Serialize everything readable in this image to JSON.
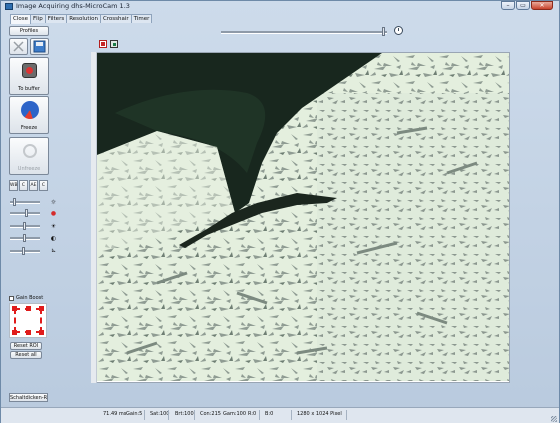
{
  "window": {
    "title": "Image Acquiring dhs-MicroCam 1.3",
    "min_glyph": "–",
    "max_glyph": "▭",
    "close_glyph": "✕"
  },
  "tabs": [
    {
      "label": "Close"
    },
    {
      "label": "Flip"
    },
    {
      "label": "Filters"
    },
    {
      "label": "Resolution"
    },
    {
      "label": "Crosshair"
    },
    {
      "label": "Timer"
    }
  ],
  "left_panel": {
    "profiles_label": "Profiles",
    "to_buffer_label": "To buffer",
    "freeze_label": "Freeze",
    "unfreeze_label": "Unfreeze",
    "wb_buttons": [
      "WB",
      "C",
      "AE",
      "C"
    ],
    "gain_boost_label": "Gain Boost",
    "reset_roi_label": "Reset ROI",
    "reset_all_label": "Reset all",
    "bottom_button_label": "Schaltdicken-Rahr"
  },
  "status": {
    "exposure": "71.49 ms",
    "gain": "Gain:5",
    "sat": "Sat:100",
    "brt": "Brt:100",
    "con": "Con:215",
    "gam": "Gam:100",
    "r": "R:0",
    "b": "B:0",
    "resolution": "1280 x 1024 Pixel"
  },
  "colors": {
    "accent": "#2c64c8",
    "roi_red": "#e01b1b",
    "micro_bg": "#e5efdf",
    "micro_dark": "#16231b",
    "micro_grain": "#8d9a90"
  },
  "icons": [
    "clock-icon",
    "camera-icon",
    "freeze-icon",
    "unfreeze-icon",
    "cross-icon",
    "save-icon",
    "brightness-icon",
    "color-icon",
    "contrast-icon",
    "gamma-icon",
    "gain-icon"
  ]
}
